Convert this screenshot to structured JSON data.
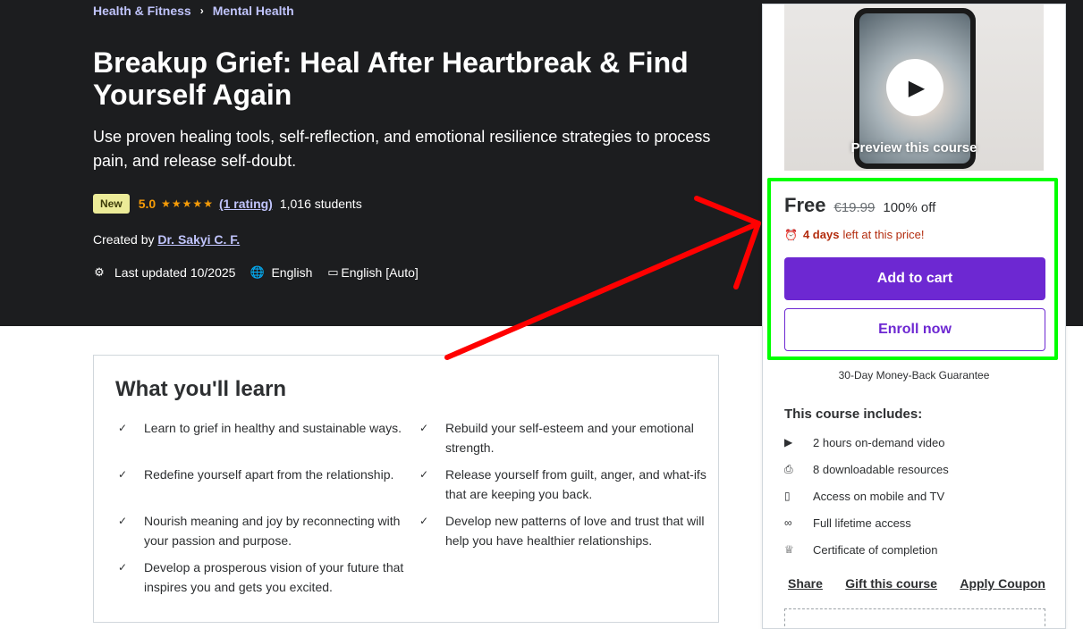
{
  "breadcrumb": [
    "Health & Fitness",
    "Mental Health"
  ],
  "course": {
    "title": "Breakup Grief: Heal After Heartbreak & Find Yourself Again",
    "subtitle": "Use proven healing tools, self-reflection, and emotional resilience strategies to process pain, and release self-doubt.",
    "badge": "New",
    "rating": "5.0",
    "stars": "★★★★★",
    "rating_count": "(1 rating)",
    "students": "1,016 students",
    "created_by_label": "Created by",
    "author": "Dr. Sakyi C. F.",
    "last_updated": "Last updated 10/2025",
    "language": "English",
    "captions": "English [Auto]"
  },
  "learn": {
    "title": "What you'll learn",
    "items": [
      "Learn to grief in healthy and sustainable ways.",
      "Rebuild your self-esteem and your emotional strength.",
      "Redefine yourself apart from the relationship.",
      "Release yourself from guilt, anger, and what-ifs that are keeping you back.",
      "Nourish meaning and joy by reconnecting with your passion and purpose.",
      "Develop new patterns of love and trust that will help you have healthier relationships.",
      "Develop a prosperous vision of your future that inspires you and gets you excited."
    ]
  },
  "sidebar": {
    "preview_label": "Preview this course",
    "price": "Free",
    "old_price": "€19.99",
    "discount": "100% off",
    "timer_bold": "4 days",
    "timer_rest": "left at this price!",
    "add_to_cart": "Add to cart",
    "enroll_now": "Enroll now",
    "guarantee": "30-Day Money-Back Guarantee",
    "includes_title": "This course includes:",
    "includes": [
      {
        "icon": "video-icon",
        "glyph": "▶",
        "text": "2 hours on-demand video"
      },
      {
        "icon": "file-download-icon",
        "glyph": "⎙",
        "text": "8 downloadable resources"
      },
      {
        "icon": "mobile-icon",
        "glyph": "▯",
        "text": "Access on mobile and TV"
      },
      {
        "icon": "infinity-icon",
        "glyph": "∞",
        "text": "Full lifetime access"
      },
      {
        "icon": "trophy-icon",
        "glyph": "♕",
        "text": "Certificate of completion"
      }
    ],
    "share": "Share",
    "gift": "Gift this course",
    "coupon": "Apply Coupon"
  },
  "colors": {
    "hero_bg": "#1c1d1f",
    "accent_purple": "#6d28d2",
    "star_orange": "#f69c08",
    "highlight_green": "#00ff00",
    "arrow_red": "#ff0000"
  }
}
